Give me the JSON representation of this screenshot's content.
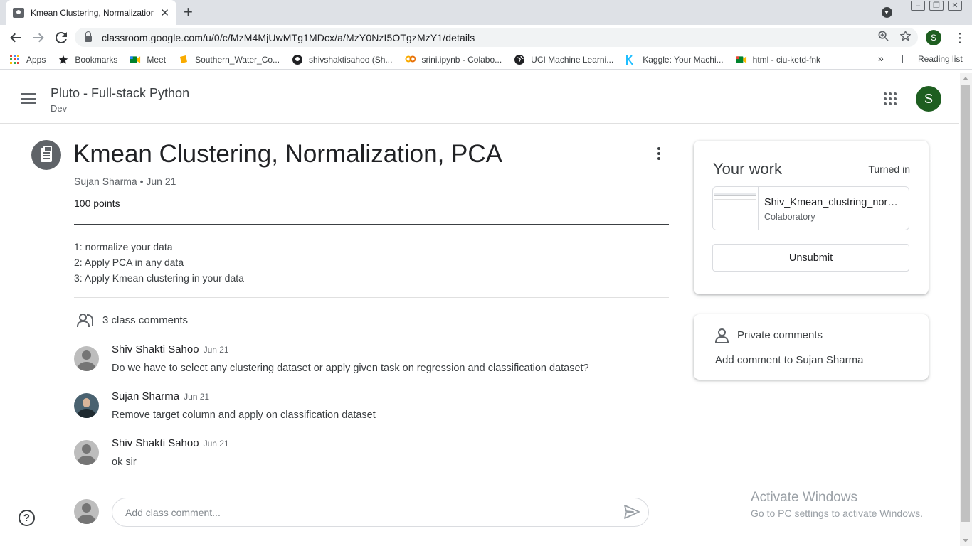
{
  "browser": {
    "tab_title": "Kmean Clustering, Normalization",
    "tab_close": "✕",
    "new_tab": "+",
    "url": "classroom.google.com/u/0/c/MzM4MjUwMTg1MDcx/a/MzY0NzI5OTgzMzY1/details",
    "profile_initial": "S",
    "bookmarks": [
      {
        "label": "Apps",
        "icon": "apps-grid-icon",
        "color": "#ea4335"
      },
      {
        "label": "Bookmarks",
        "icon": "star-icon",
        "color": "#202124"
      },
      {
        "label": "Meet",
        "icon": "meet-icon",
        "color": "#00832d"
      },
      {
        "label": "Southern_Water_Co...",
        "icon": "colab-notebook-icon",
        "color": "#f9ab00"
      },
      {
        "label": "shivshaktisahoo (Sh...",
        "icon": "github-icon",
        "color": "#202124"
      },
      {
        "label": "srini.ipynb - Colabo...",
        "icon": "colab-icon",
        "color": "#f9ab00"
      },
      {
        "label": "UCI Machine Learni...",
        "icon": "globe-icon",
        "color": "#202124"
      },
      {
        "label": "Kaggle: Your Machi...",
        "icon": "kaggle-icon",
        "color": "#20beff"
      },
      {
        "label": "html - ciu-ketd-fnk",
        "icon": "meet-icon",
        "color": "#00832d"
      }
    ],
    "bookmarks_more": "»",
    "reading_list": "Reading list"
  },
  "header": {
    "class_name": "Pluto - Full-stack Python",
    "section": "Dev",
    "account_initial": "S"
  },
  "assignment": {
    "title": "Kmean Clustering, Normalization, PCA",
    "author_line": "Sujan Sharma • Jun 21",
    "points": "100 points",
    "instructions": [
      "1: normalize your data",
      "2: Apply PCA in any data",
      "3: Apply Kmean clustering in your data"
    ]
  },
  "comments": {
    "count_label": "3 class comments",
    "items": [
      {
        "name": "Shiv Shakti Sahoo",
        "date": "Jun 21",
        "text": "Do we have to select any clustering  dataset or apply given task on regression and classification dataset?"
      },
      {
        "name": "Sujan Sharma",
        "date": "Jun 21",
        "text": "Remove target column and apply on classification dataset"
      },
      {
        "name": "Shiv Shakti Sahoo",
        "date": "Jun 21",
        "text": "ok sir"
      }
    ],
    "add_placeholder": "Add class comment..."
  },
  "your_work": {
    "title": "Your work",
    "status": "Turned in",
    "attachment_name": "Shiv_Kmean_clustring_normalization_pca.ipynb",
    "attachment_type": "Colaboratory",
    "unsubmit_label": "Unsubmit"
  },
  "private_comments": {
    "title": "Private comments",
    "add_label": "Add comment to Sujan Sharma"
  },
  "watermark": {
    "title": "Activate Windows",
    "subtitle": "Go to PC settings to activate Windows."
  },
  "help_glyph": "?",
  "colors": {
    "account_green": "#1e5e20",
    "text_primary": "#202124",
    "text_secondary": "#5f6368"
  }
}
